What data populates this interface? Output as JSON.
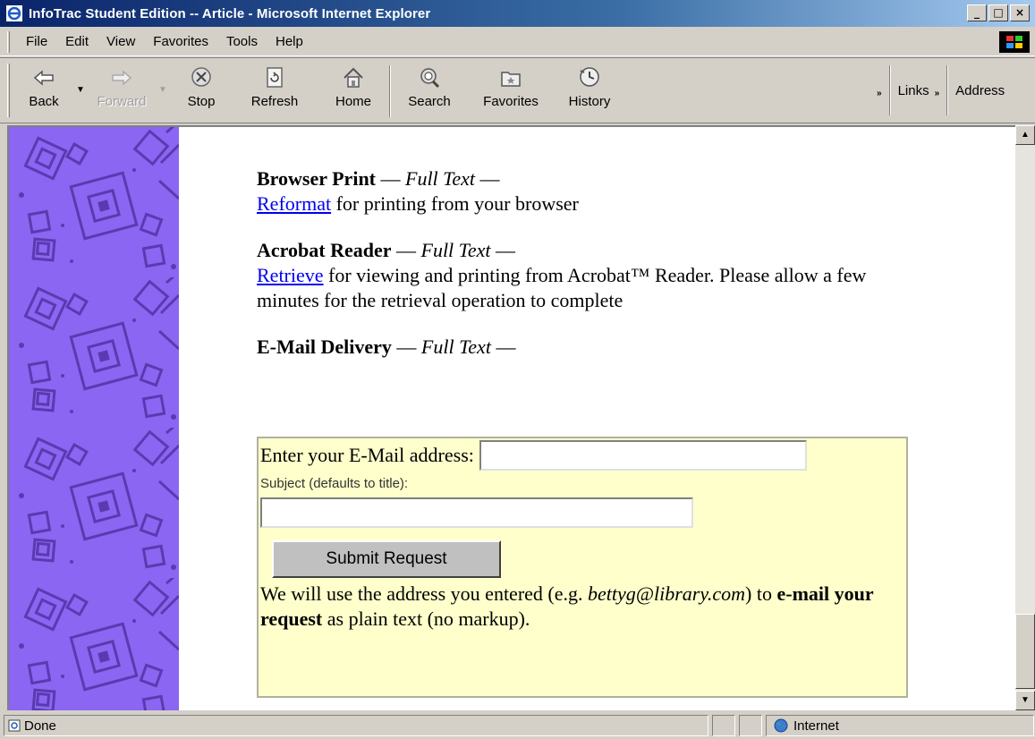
{
  "window": {
    "title": "InfoTrac Student Edition -- Article - Microsoft Internet Explorer",
    "buttons": {
      "minimize": "_",
      "maximize": "□",
      "close": "×"
    }
  },
  "menu": {
    "items": [
      "File",
      "Edit",
      "View",
      "Favorites",
      "Tools",
      "Help"
    ]
  },
  "toolbar": {
    "buttons": [
      {
        "label": "Back",
        "icon": "back-arrow-icon"
      },
      {
        "label": "Forward",
        "icon": "forward-arrow-icon",
        "disabled": true
      },
      {
        "label": "Stop",
        "icon": "stop-icon"
      },
      {
        "label": "Refresh",
        "icon": "refresh-icon"
      },
      {
        "label": "Home",
        "icon": "home-icon"
      },
      {
        "label": "Search",
        "icon": "search-icon"
      },
      {
        "label": "Favorites",
        "icon": "favorites-folder-icon"
      },
      {
        "label": "History",
        "icon": "history-icon"
      }
    ],
    "chevron": "»",
    "links_label": "Links",
    "address_label": "Address"
  },
  "article": {
    "browser_print": {
      "title": "Browser Print",
      "dash1": " — ",
      "full_text": "Full Text",
      "dash2": " —",
      "link": "Reformat",
      "desc": " for printing from your browser"
    },
    "acrobat": {
      "title": "Acrobat Reader",
      "dash1": " — ",
      "full_text": "Full Text",
      "dash2": " —",
      "link": "Retrieve",
      "desc": " for viewing and printing from Acrobat™ Reader. Please allow a few minutes for the retrieval operation to complete"
    },
    "email": {
      "title": "E-Mail Delivery",
      "dash1": " — ",
      "full_text": "Full Text",
      "dash2": " —",
      "address_label": "Enter your E-Mail address:",
      "address_value": "",
      "subject_label": "Subject (defaults to title):",
      "subject_value": "",
      "submit_label": "Submit Request",
      "note_part1": "We will use the address you entered (e.g. ",
      "note_example": "bettyg@library.com",
      "note_part2": ") to ",
      "note_bold1": "e-mail",
      "note_part3": " ",
      "note_bold2": "your request",
      "note_part4": " as plain text (no markup)."
    }
  },
  "statusbar": {
    "status": "Done",
    "zone": "Internet"
  },
  "colors": {
    "sidebar": "#8a66f2",
    "email_box": "#ffffcc",
    "link": "#0000ee",
    "titlebar": "#0a246a"
  }
}
